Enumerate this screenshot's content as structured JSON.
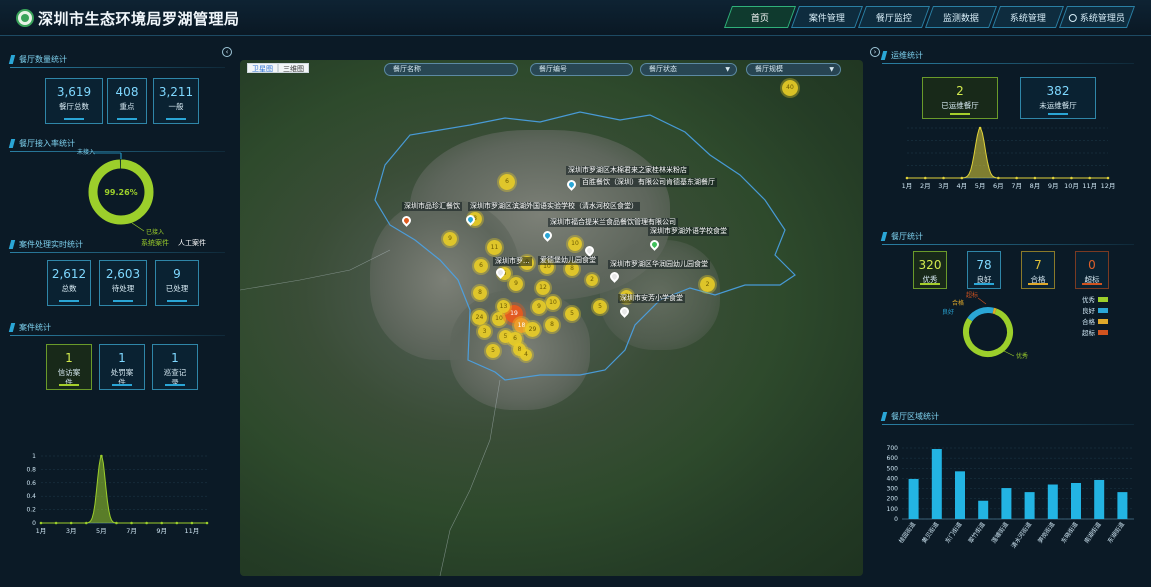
{
  "app": {
    "title": "深圳市生态环境局罗湖管理局"
  },
  "nav": [
    {
      "label": "首页",
      "active": true
    },
    {
      "label": "案件管理"
    },
    {
      "label": "餐厅监控"
    },
    {
      "label": "监测数据"
    },
    {
      "label": "系统管理"
    },
    {
      "label": "系统管理员"
    }
  ],
  "left": {
    "restaurant_count": {
      "title": "餐厅数量统计",
      "items": [
        {
          "value": "3,619",
          "label": "餐厅总数"
        },
        {
          "value": "408",
          "label": "重点"
        },
        {
          "value": "3,211",
          "label": "一般"
        }
      ]
    },
    "access_rate": {
      "title": "餐厅接入率统计",
      "percent": "99.26%",
      "fraction": 0.9926,
      "label_not": "未接入",
      "label_done": "已接入",
      "legend_system": "系统案件",
      "legend_manual": "人工案件"
    },
    "case_realtime": {
      "title": "案件处理实时统计",
      "items": [
        {
          "value": "2,612",
          "label": "总数"
        },
        {
          "value": "2,603",
          "label": "待处理"
        },
        {
          "value": "9",
          "label": "已处理"
        }
      ]
    },
    "case_stats": {
      "title": "案件统计",
      "items": [
        {
          "value": "1",
          "label": "信访案件",
          "green": true
        },
        {
          "value": "1",
          "label": "处罚案件"
        },
        {
          "value": "1",
          "label": "巡查记录"
        }
      ]
    }
  },
  "map": {
    "toggle": [
      "卫星图",
      "三维图"
    ],
    "filters": [
      "餐厅名称",
      "餐厅编号",
      "餐厅状态",
      "餐厅规模"
    ],
    "labels": [
      "深圳市罗湖区木棉君来之家桂林米粉店",
      "百胜餐饮（深圳）有限公司肯德基东湖餐厅",
      "深圳市品珍汇餐饮",
      "深圳市罗湖区滨湖外国语实验学校（清水河校区食堂）",
      "深圳市福合提米兰食品餐饮管理有限公司",
      "深圳市罗湖外语学校食堂",
      "深圳市罗...",
      "爱德堡幼儿园食堂",
      "深圳市罗湖区华润园幼儿园食堂",
      "深圳市安芳小学食堂"
    ],
    "clusters": [
      "40",
      "6",
      "8",
      "9",
      "10",
      "11",
      "6",
      "9",
      "5",
      "10",
      "8",
      "9",
      "12",
      "2",
      "8",
      "24",
      "10",
      "19",
      "9",
      "10",
      "5",
      "5",
      "18",
      "29",
      "8",
      "3",
      "5",
      "6",
      "8",
      "5",
      "2",
      "2",
      "4",
      "13"
    ]
  },
  "right": {
    "ops": {
      "title": "运维统计",
      "items": [
        {
          "value": "2",
          "label": "已运维餐厅",
          "green": true
        },
        {
          "value": "382",
          "label": "未运维餐厅"
        }
      ]
    },
    "restaurant_stats": {
      "title": "餐厅统计",
      "items": [
        {
          "value": "320",
          "label": "优秀",
          "green": true
        },
        {
          "value": "78",
          "label": "良好"
        },
        {
          "value": "7",
          "label": "合格",
          "yellow": true
        },
        {
          "value": "0",
          "label": "超标",
          "red": true
        }
      ],
      "legend": [
        {
          "name": "优秀",
          "color": "#9ccf2b"
        },
        {
          "name": "良好",
          "color": "#2aa6d6"
        },
        {
          "name": "合格",
          "color": "#e0a92a"
        },
        {
          "name": "超标",
          "color": "#d2531f"
        }
      ],
      "donut_labels": {
        "top": "超标",
        "mid": "合格",
        "left": "良好",
        "bottom": "优秀"
      }
    },
    "region": {
      "title": "餐厅区域统计"
    }
  },
  "chart_data": [
    {
      "type": "area",
      "id": "left-case-trend",
      "x": [
        "1月",
        "2月",
        "3月",
        "4月",
        "5月",
        "6月",
        "7月",
        "8月",
        "9月",
        "10月",
        "11月",
        "12月"
      ],
      "x_tick_labels": [
        "1月",
        "3月",
        "5月",
        "7月",
        "9月",
        "11月"
      ],
      "values": [
        0,
        0,
        0,
        0,
        1,
        0,
        0,
        0,
        0,
        0,
        0,
        0
      ],
      "ylim": [
        0,
        1
      ],
      "y_ticks": [
        "0",
        "0.2",
        "0.4",
        "0.6",
        "0.8",
        "1"
      ],
      "color": "#9ccf2b"
    },
    {
      "type": "area",
      "id": "right-ops-trend",
      "x": [
        "1月",
        "2月",
        "3月",
        "4月",
        "5月",
        "6月",
        "7月",
        "8月",
        "9月",
        "10月",
        "11月",
        "12月"
      ],
      "values": [
        0,
        0,
        0,
        0,
        2,
        0,
        0,
        0,
        0,
        0,
        0,
        0
      ],
      "color": "#e0d23a"
    },
    {
      "type": "pie",
      "id": "restaurant-donut",
      "labels": [
        "优秀",
        "良好",
        "合格",
        "超标"
      ],
      "values": [
        320,
        78,
        7,
        0
      ],
      "colors": [
        "#9ccf2b",
        "#2aa6d6",
        "#e0a92a",
        "#d2531f"
      ]
    },
    {
      "type": "bar",
      "id": "region-bar",
      "categories": [
        "桂园街道",
        "黄贝街道",
        "东门街道",
        "翠竹街道",
        "莲塘街道",
        "清水河街道",
        "笋岗街道",
        "东晓街道",
        "南湖街道",
        "东湖街道"
      ],
      "values": [
        395,
        690,
        470,
        180,
        305,
        265,
        340,
        355,
        385,
        265
      ],
      "ylim": [
        0,
        700
      ],
      "y_ticks": [
        "0",
        "100",
        "200",
        "300",
        "400",
        "500",
        "600",
        "700"
      ],
      "color": "#23b4e3"
    }
  ]
}
